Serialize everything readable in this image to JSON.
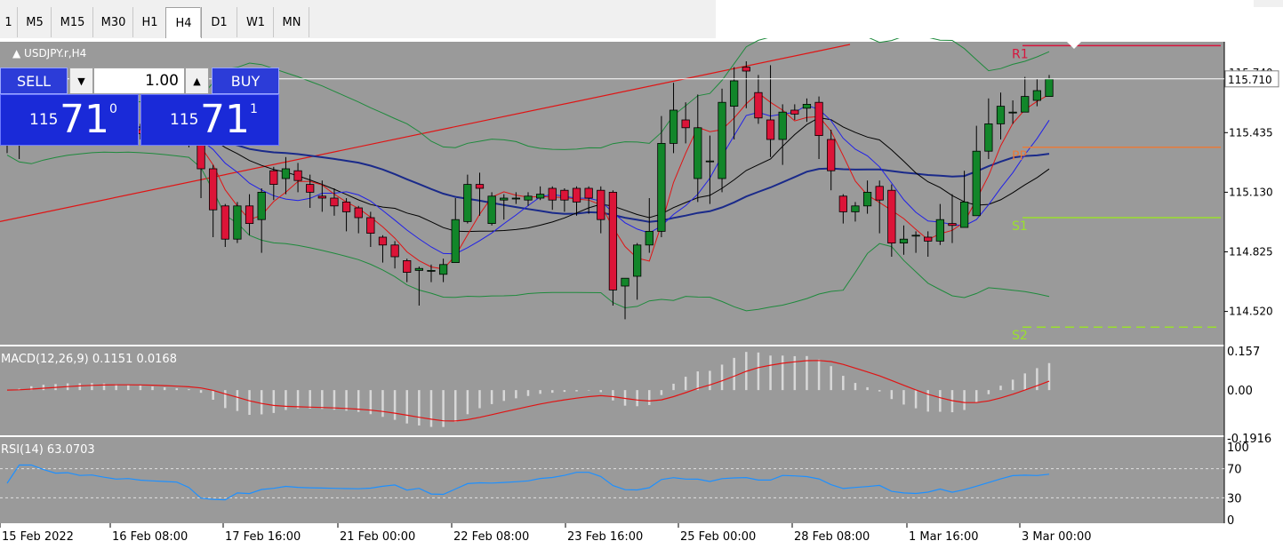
{
  "toolbar": {
    "timeframes": [
      "1",
      "M5",
      "M15",
      "M30",
      "H1",
      "H4",
      "D1",
      "W1",
      "MN"
    ],
    "active": "H4"
  },
  "chart": {
    "symbol_label": "USDJPY.r,H4",
    "current_price_tag": "115.710"
  },
  "trade_panel": {
    "sell_label": "SELL",
    "buy_label": "BUY",
    "lot": "1.00",
    "sell_big": "115",
    "sell_pips": "71",
    "sell_sup": "0",
    "buy_big": "115",
    "buy_pips": "71",
    "buy_sup": "1"
  },
  "chart_data": [
    {
      "type": "candlestick",
      "symbol": "USDJPY.r",
      "timeframe": "H4",
      "y_ticks": [
        "115.740",
        "115.435",
        "115.130",
        "114.825",
        "114.520"
      ],
      "ylim": [
        114.35,
        115.9
      ],
      "x_ticks": [
        "15 Feb 2022",
        "16 Feb 08:00",
        "17 Feb 16:00",
        "21 Feb 00:00",
        "22 Feb 08:00",
        "23 Feb 16:00",
        "25 Feb 00:00",
        "28 Feb 08:00",
        "1 Mar 16:00",
        "3 Mar 00:00"
      ],
      "levels": [
        {
          "name": "R1",
          "value": 115.88,
          "color": "#d8143c"
        },
        {
          "name": "PP",
          "value": 115.36,
          "color": "#e87a3a"
        },
        {
          "name": "S1",
          "value": 115.0,
          "color": "#9ae02c"
        },
        {
          "name": "S2",
          "value": 114.44,
          "color": "#9ae02c"
        }
      ],
      "candles": [
        [
          115.42,
          115.38,
          115.48,
          115.33
        ],
        [
          115.38,
          115.45,
          115.49,
          115.3
        ],
        [
          115.45,
          115.52,
          115.6,
          115.4
        ],
        [
          115.52,
          115.5,
          115.56,
          115.45
        ],
        [
          115.5,
          115.48,
          115.55,
          115.44
        ],
        [
          115.48,
          115.49,
          115.52,
          115.43
        ],
        [
          115.49,
          115.47,
          115.53,
          115.43
        ],
        [
          115.47,
          115.48,
          115.52,
          115.44
        ],
        [
          115.48,
          115.46,
          115.5,
          115.43
        ],
        [
          115.46,
          115.44,
          115.49,
          115.4
        ],
        [
          115.44,
          115.45,
          115.48,
          115.41
        ],
        [
          115.45,
          115.43,
          115.48,
          115.4
        ],
        [
          115.43,
          115.42,
          115.47,
          115.39
        ],
        [
          115.42,
          115.41,
          115.45,
          115.38
        ],
        [
          115.41,
          115.4,
          115.44,
          115.37
        ],
        [
          115.4,
          115.39,
          115.43,
          115.36
        ],
        [
          115.39,
          115.25,
          115.4,
          115.1
        ],
        [
          115.25,
          115.04,
          115.27,
          114.9
        ],
        [
          115.06,
          114.89,
          115.07,
          114.85
        ],
        [
          114.89,
          115.06,
          115.08,
          114.87
        ],
        [
          115.06,
          114.97,
          115.12,
          114.91
        ],
        [
          114.99,
          115.13,
          115.15,
          114.82
        ],
        [
          115.24,
          115.17,
          115.26,
          115.09
        ],
        [
          115.2,
          115.25,
          115.31,
          115.12
        ],
        [
          115.24,
          115.19,
          115.28,
          115.13
        ],
        [
          115.17,
          115.13,
          115.22,
          115.05
        ],
        [
          115.11,
          115.1,
          115.19,
          115.03
        ],
        [
          115.1,
          115.06,
          115.15,
          115.01
        ],
        [
          115.08,
          115.03,
          115.1,
          114.93
        ],
        [
          115.05,
          115.0,
          115.06,
          114.92
        ],
        [
          115.0,
          114.92,
          115.03,
          114.85
        ],
        [
          114.9,
          114.86,
          114.91,
          114.77
        ],
        [
          114.86,
          114.8,
          114.88,
          114.74
        ],
        [
          114.78,
          114.72,
          114.79,
          114.67
        ],
        [
          114.73,
          114.74,
          114.75,
          114.55
        ],
        [
          114.73,
          114.73,
          114.76,
          114.67
        ],
        [
          114.71,
          114.76,
          114.79,
          114.67
        ],
        [
          114.77,
          114.99,
          115.1,
          114.8
        ],
        [
          114.98,
          115.17,
          115.22,
          114.97
        ],
        [
          115.17,
          115.15,
          115.23,
          115.01
        ],
        [
          114.97,
          115.11,
          115.13,
          114.96
        ],
        [
          115.09,
          115.1,
          115.12,
          114.99
        ],
        [
          115.1,
          115.1,
          115.13,
          115.07
        ],
        [
          115.09,
          115.11,
          115.13,
          115.06
        ],
        [
          115.1,
          115.12,
          115.16,
          115.09
        ],
        [
          115.15,
          115.09,
          115.16,
          115.04
        ],
        [
          115.14,
          115.09,
          115.15,
          115.03
        ],
        [
          115.15,
          115.08,
          115.16,
          115.01
        ],
        [
          115.15,
          115.1,
          115.16,
          115.02
        ],
        [
          115.14,
          114.99,
          115.16,
          114.92
        ],
        [
          115.13,
          114.63,
          115.14,
          114.55
        ],
        [
          114.65,
          114.69,
          114.69,
          114.48
        ],
        [
          114.7,
          114.86,
          114.87,
          114.58
        ],
        [
          114.86,
          114.93,
          115.1,
          114.82
        ],
        [
          114.93,
          115.38,
          115.52,
          114.9
        ],
        [
          115.38,
          115.55,
          115.69,
          115.33
        ],
        [
          115.5,
          115.46,
          115.59,
          115.38
        ],
        [
          115.2,
          115.46,
          115.63,
          115.08
        ],
        [
          115.29,
          115.29,
          115.42,
          115.07
        ],
        [
          115.2,
          115.59,
          115.66,
          115.13
        ],
        [
          115.57,
          115.7,
          115.77,
          115.4
        ],
        [
          115.77,
          115.75,
          115.8,
          115.56
        ],
        [
          115.64,
          115.51,
          115.73,
          115.48
        ],
        [
          115.5,
          115.4,
          115.78,
          115.31
        ],
        [
          115.4,
          115.54,
          115.58,
          115.27
        ],
        [
          115.55,
          115.53,
          115.58,
          115.5
        ],
        [
          115.56,
          115.58,
          115.61,
          115.49
        ],
        [
          115.59,
          115.42,
          115.62,
          115.3
        ],
        [
          115.4,
          115.24,
          115.45,
          115.14
        ],
        [
          115.11,
          115.03,
          115.12,
          114.97
        ],
        [
          115.03,
          115.06,
          115.08,
          114.98
        ],
        [
          115.06,
          115.13,
          115.19,
          115.02
        ],
        [
          115.16,
          115.09,
          115.19,
          114.92
        ],
        [
          115.14,
          114.87,
          115.17,
          114.8
        ],
        [
          114.87,
          114.89,
          114.96,
          114.81
        ],
        [
          114.91,
          114.91,
          114.93,
          114.82
        ],
        [
          114.9,
          114.88,
          114.93,
          114.8
        ],
        [
          114.88,
          114.99,
          115.07,
          114.86
        ],
        [
          114.97,
          114.96,
          115.12,
          114.87
        ],
        [
          114.95,
          115.08,
          115.24,
          114.95
        ],
        [
          115.01,
          115.34,
          115.47,
          115.01
        ],
        [
          115.34,
          115.48,
          115.61,
          115.3
        ],
        [
          115.48,
          115.57,
          115.64,
          115.4
        ],
        [
          115.54,
          115.54,
          115.6,
          115.48
        ],
        [
          115.54,
          115.62,
          115.72,
          115.55
        ],
        [
          115.6,
          115.65,
          115.71,
          115.57
        ],
        [
          115.62,
          115.71,
          115.73,
          115.65
        ]
      ]
    },
    {
      "type": "line",
      "title": "MACD(12,26,9) 0.1151 0.0168",
      "y_ticks": [
        "0.157",
        "0.00",
        "-0.1916"
      ]
    },
    {
      "type": "line",
      "title": "RSI(14) 63.0703",
      "y_ticks": [
        "100",
        "70",
        "30",
        "0"
      ]
    }
  ]
}
